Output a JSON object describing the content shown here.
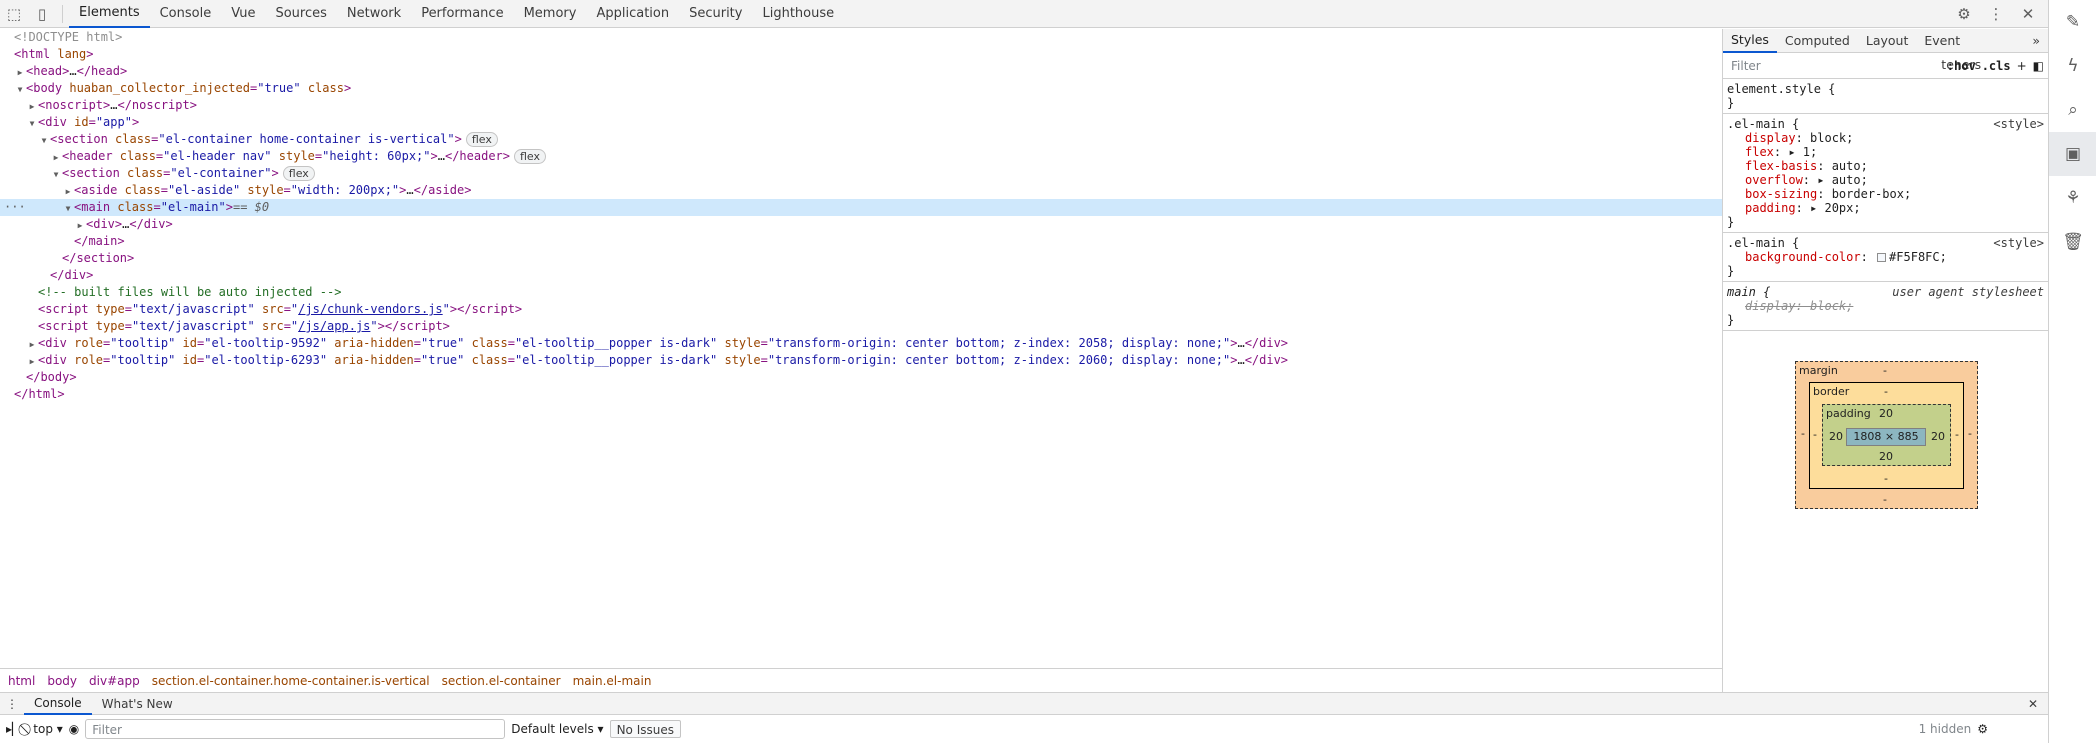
{
  "topbar": {
    "tabs": [
      "Elements",
      "Console",
      "Vue",
      "Sources",
      "Network",
      "Performance",
      "Memory",
      "Application",
      "Security",
      "Lighthouse"
    ],
    "active_tab": "Elements"
  },
  "dom": {
    "doctype": "<!DOCTYPE html>",
    "html_open": "lang",
    "head": "…",
    "body_attr1": "huaban_collector_injected",
    "body_val1": "\"true\"",
    "body_attr2": "class",
    "noscript": "…",
    "app_id": "\"app\"",
    "section_class": "\"el-container home-container is-vertical\"",
    "header_class": "\"el-header nav\"",
    "header_style": "\"height: 60px;\"",
    "section2_class": "\"el-container\"",
    "aside_class": "\"el-aside\"",
    "aside_style": "\"width: 200px;\"",
    "main_class": "\"el-main\"",
    "main_eq": "== $0",
    "comment": "<!-- built files will be auto injected -->",
    "script1_type": "\"text/javascript\"",
    "script1_src": "/js/chunk-vendors.js",
    "script2_type": "\"text/javascript\"",
    "script2_src": "/js/app.js",
    "tooltip1_id": "\"el-tooltip-9592\"",
    "tooltip1_style": "\"transform-origin: center bottom; z-index: 2058; display: none;\"",
    "tooltip2_id": "\"el-tooltip-6293\"",
    "tooltip2_style": "\"transform-origin: center bottom; z-index: 2060; display: none;\"",
    "tooltip_role": "\"tooltip\"",
    "tooltip_aria": "\"true\"",
    "tooltip_class": "\"el-tooltip__popper is-dark\"",
    "badge_flex": "flex"
  },
  "breadcrumbs": [
    "html",
    "body",
    "div#app",
    "section.el-container.home-container.is-vertical",
    "section.el-container",
    "main.el-main"
  ],
  "styles": {
    "tabs": [
      "Styles",
      "Computed",
      "Layout",
      "Event Listeners"
    ],
    "filter_placeholder": "Filter",
    "hov": ":hov",
    "cls": ".cls",
    "element_style": "element.style {",
    "rule1_selector": ".el-main {",
    "rule1_origin": "<style>",
    "rule1_props": [
      {
        "name": "display",
        "value": "block;"
      },
      {
        "name": "flex",
        "value": "▸ 1;"
      },
      {
        "name": "flex-basis",
        "value": "auto;"
      },
      {
        "name": "overflow",
        "value": "▸ auto;"
      },
      {
        "name": "box-sizing",
        "value": "border-box;"
      },
      {
        "name": "padding",
        "value": "▸ 20px;"
      }
    ],
    "rule2_selector": ".el-main {",
    "rule2_origin": "<style>",
    "rule2_prop": "background-color",
    "rule2_value": "#F5F8FC;",
    "rule3_selector": "main {",
    "rule3_origin": "user agent stylesheet",
    "rule3_prop": "display: block;",
    "close": "}"
  },
  "boxmodel": {
    "margin_label": "margin",
    "border_label": "border",
    "padding_label": "padding",
    "dash": "-",
    "padding_top": "20",
    "padding_left": "20",
    "padding_right": "20",
    "padding_bottom": "20",
    "content": "1808 × 885"
  },
  "drawer": {
    "tabs": [
      "Console",
      "What's New"
    ],
    "context": "top ▾",
    "filter_placeholder": "Filter",
    "levels": "Default levels ▾",
    "issues": "No Issues",
    "hidden": "1 hidden"
  },
  "colors": {
    "accent": "#0b57d0",
    "selected_row": "#cfe8fc",
    "swatch": "#F5F8FC"
  }
}
